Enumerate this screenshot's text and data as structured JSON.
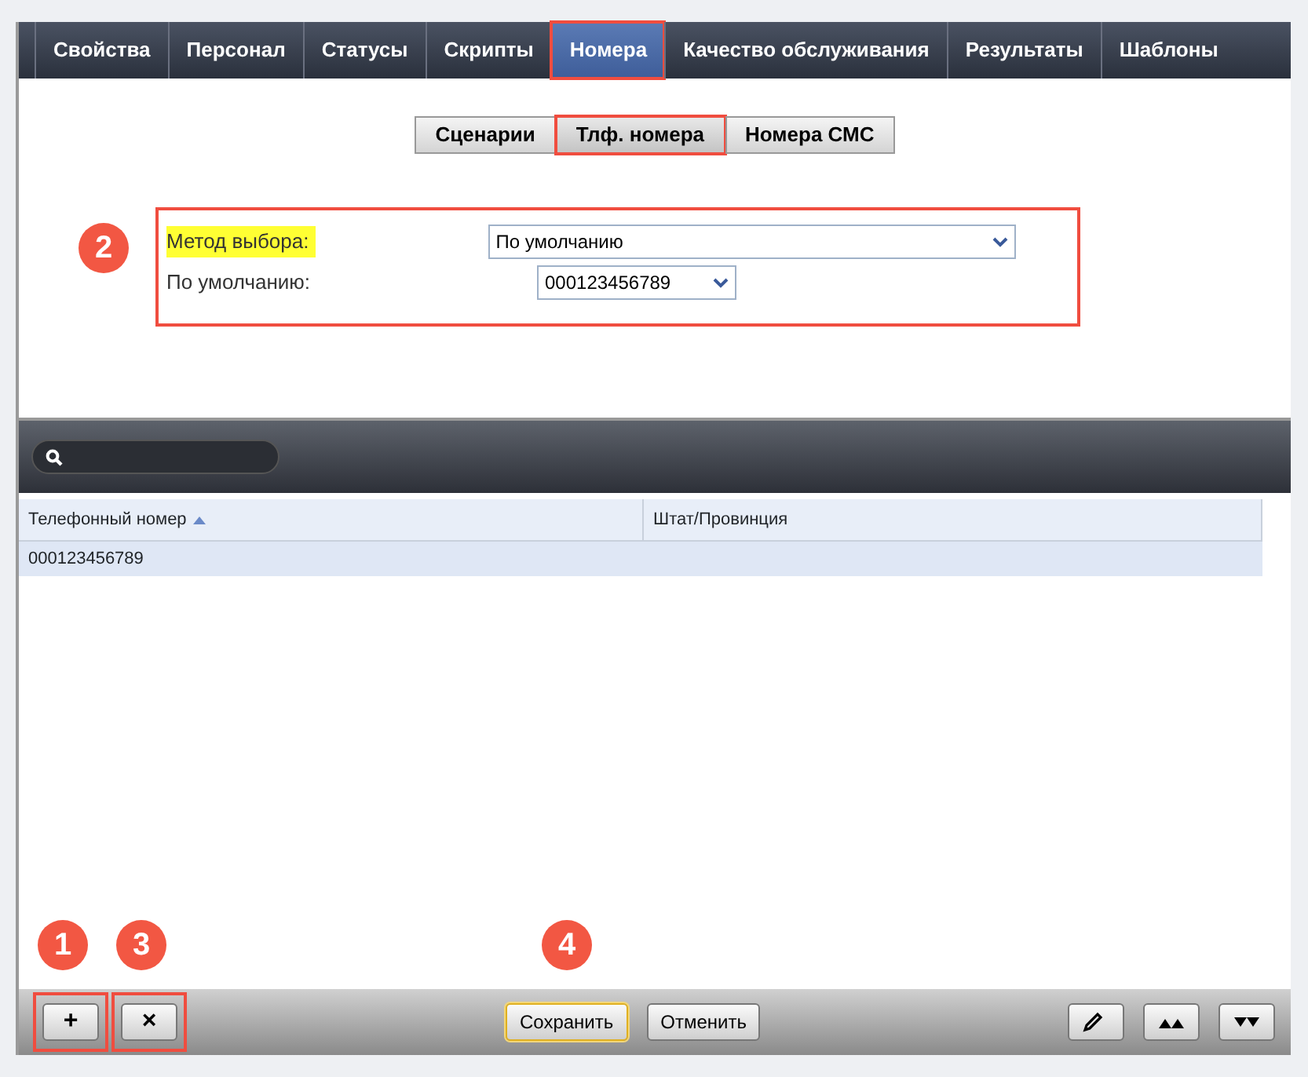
{
  "tabs": [
    {
      "label": "Свойства",
      "selected": false,
      "highlighted": false
    },
    {
      "label": "Персонал",
      "selected": false,
      "highlighted": false
    },
    {
      "label": "Статусы",
      "selected": false,
      "highlighted": false
    },
    {
      "label": "Скрипты",
      "selected": false,
      "highlighted": false
    },
    {
      "label": "Номера",
      "selected": true,
      "highlighted": true
    },
    {
      "label": "Качество обслуживания",
      "selected": false,
      "highlighted": false
    },
    {
      "label": "Результаты",
      "selected": false,
      "highlighted": false
    },
    {
      "label": "Шаблоны",
      "selected": false,
      "highlighted": false
    }
  ],
  "steps": [
    {
      "label": "Сценарии",
      "selected": false,
      "highlighted": false
    },
    {
      "label": "Тлф. номера",
      "selected": true,
      "highlighted": true
    },
    {
      "label": "Номера СМС",
      "selected": false,
      "highlighted": false
    }
  ],
  "form": {
    "callout": "2",
    "highlighted": true,
    "fields": [
      {
        "label": "Метод выбора:",
        "value": "По умолчанию",
        "label_highlighted": true,
        "wide": true
      },
      {
        "label": "По умолчанию:",
        "value": "000123456789",
        "label_highlighted": false,
        "wide": false
      }
    ]
  },
  "table": {
    "columns": [
      {
        "label": "Телефонный номер",
        "sorted": true
      },
      {
        "label": "Штат/Провинция",
        "sorted": false
      }
    ],
    "rows": [
      {
        "cells": [
          "000123456789",
          ""
        ],
        "selected": true
      }
    ]
  },
  "toolbar": {
    "left": [
      {
        "label": "+",
        "callout": "1",
        "highlighted": true
      },
      {
        "label": "×",
        "callout": "3",
        "highlighted": true
      }
    ],
    "center": [
      {
        "label": "Сохранить",
        "default": true,
        "callout": "4"
      },
      {
        "label": "Отменить",
        "default": false
      }
    ],
    "right": [
      {
        "kind": "edit"
      },
      {
        "kind": "up"
      },
      {
        "kind": "down"
      }
    ]
  }
}
